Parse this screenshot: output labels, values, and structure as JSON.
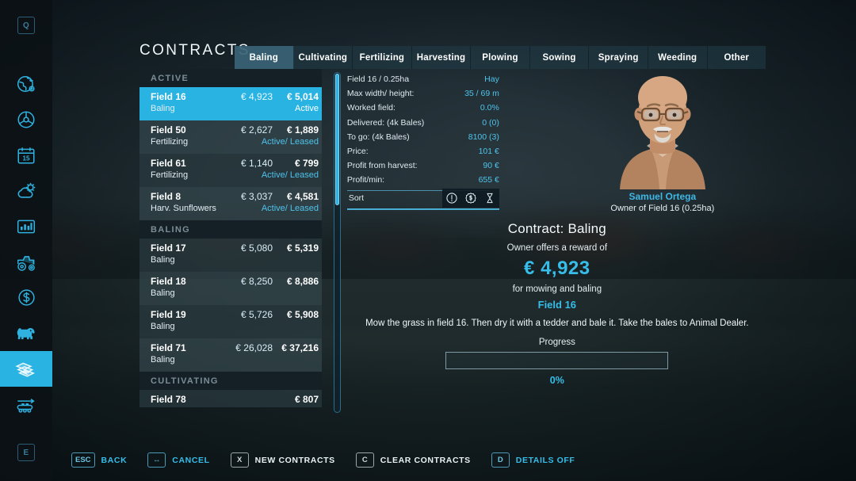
{
  "rail": {
    "top_key": "Q",
    "bottom_key": "E",
    "items": [
      {
        "icon": "globe-icon",
        "active": false
      },
      {
        "icon": "steering-wheel-icon",
        "active": false
      },
      {
        "icon": "calendar-icon",
        "label": "15",
        "active": false
      },
      {
        "icon": "weather-icon",
        "active": false
      },
      {
        "icon": "statistics-icon",
        "active": false
      },
      {
        "icon": "tractor-icon",
        "active": false
      },
      {
        "icon": "finances-icon",
        "active": false
      },
      {
        "icon": "animals-icon",
        "active": false
      },
      {
        "icon": "contracts-icon",
        "active": true
      },
      {
        "icon": "production-icon",
        "active": false
      }
    ]
  },
  "header": {
    "title": "CONTRACTS",
    "tabs": [
      {
        "label": "Baling",
        "active": true
      },
      {
        "label": "Cultivating",
        "active": false
      },
      {
        "label": "Fertilizing",
        "active": false
      },
      {
        "label": "Harvesting",
        "active": false
      },
      {
        "label": "Plowing",
        "active": false
      },
      {
        "label": "Sowing",
        "active": false
      },
      {
        "label": "Spraying",
        "active": false
      },
      {
        "label": "Weeding",
        "active": false
      },
      {
        "label": "Other",
        "active": false
      }
    ]
  },
  "list": {
    "groups": [
      {
        "header": "ACTIVE",
        "rows": [
          {
            "field": "Field 16",
            "type": "Baling",
            "value1": "€ 4,923",
            "value2": "€ 5,014",
            "state": "Active",
            "selected": true
          },
          {
            "field": "Field 50",
            "type": "Fertilizing",
            "value1": "€ 2,627",
            "value2": "€ 1,889",
            "state": "Active/ Leased",
            "selected": false
          },
          {
            "field": "Field 61",
            "type": "Fertilizing",
            "value1": "€ 1,140",
            "value2": "€ 799",
            "state": "Active/ Leased",
            "selected": false
          },
          {
            "field": "Field 8",
            "type": "Harv. Sunflowers",
            "value1": "€ 3,037",
            "value2": "€ 4,581",
            "state": "Active/ Leased",
            "selected": false
          }
        ]
      },
      {
        "header": "BALING",
        "rows": [
          {
            "field": "Field 17",
            "type": "Baling",
            "value1": "€ 5,080",
            "value2": "€ 5,319",
            "state": "",
            "selected": false
          },
          {
            "field": "Field 18",
            "type": "Baling",
            "value1": "€ 8,250",
            "value2": "€ 8,886",
            "state": "",
            "selected": false
          },
          {
            "field": "Field 19",
            "type": "Baling",
            "value1": "€ 5,726",
            "value2": "€ 5,908",
            "state": "",
            "selected": false
          },
          {
            "field": "Field 71",
            "type": "Baling",
            "value1": "€ 26,028",
            "value2": "€ 37,216",
            "state": "",
            "selected": false
          }
        ]
      },
      {
        "header": "CULTIVATING",
        "rows": [
          {
            "field": "Field 78",
            "type": "",
            "value1": "",
            "value2": "€ 807",
            "state": "",
            "selected": false
          }
        ]
      }
    ]
  },
  "stats": [
    {
      "label": "Field 16 / 0.25ha",
      "value": "Hay"
    },
    {
      "label": "Max width/ height:",
      "value": "35 / 69 m"
    },
    {
      "label": "Worked field:",
      "value": "0.0%"
    },
    {
      "label": "Delivered: (4k Bales)",
      "value": "0 (0)"
    },
    {
      "label": "To go: (4k Bales)",
      "value": "8100 (3)"
    },
    {
      "label": "Price:",
      "value": "101 €"
    },
    {
      "label": "Profit from harvest:",
      "value": "90 €"
    },
    {
      "label": "Profit/min:",
      "value": "655 €"
    }
  ],
  "sort": {
    "label": "Sort",
    "icons": [
      "exclamation-circle-icon",
      "money-badge-icon",
      "hourglass-icon"
    ]
  },
  "owner": {
    "name": "Samuel Ortega",
    "subtitle": "Owner of Field 16 (0.25ha)"
  },
  "contract": {
    "title": "Contract: Baling",
    "offer_text": "Owner offers a reward of",
    "reward": "€ 4,923",
    "for_text": "for mowing and baling",
    "field": "Field 16",
    "description": "Mow the grass in field 16. Then dry it with a tedder and bale it. Take the bales to Animal Dealer.",
    "progress_label": "Progress",
    "progress_value": "0%",
    "progress_percent": 0
  },
  "footer": [
    {
      "key": "ESC",
      "label": "BACK",
      "key_style": "blue",
      "label_style": "blue"
    },
    {
      "key": "↔",
      "label": "CANCEL",
      "key_style": "blue",
      "label_style": "blue"
    },
    {
      "key": "X",
      "label": "NEW CONTRACTS",
      "key_style": "grey",
      "label_style": "white"
    },
    {
      "key": "C",
      "label": "CLEAR CONTRACTS",
      "key_style": "grey",
      "label_style": "white"
    },
    {
      "key": "D",
      "label": "DETAILS OFF",
      "key_style": "blue",
      "label_style": "blue"
    }
  ],
  "colors": {
    "accent": "#29b3e3",
    "accent_text": "#37bdea",
    "panel": "#2a3a40",
    "group_header": "#151f26"
  }
}
